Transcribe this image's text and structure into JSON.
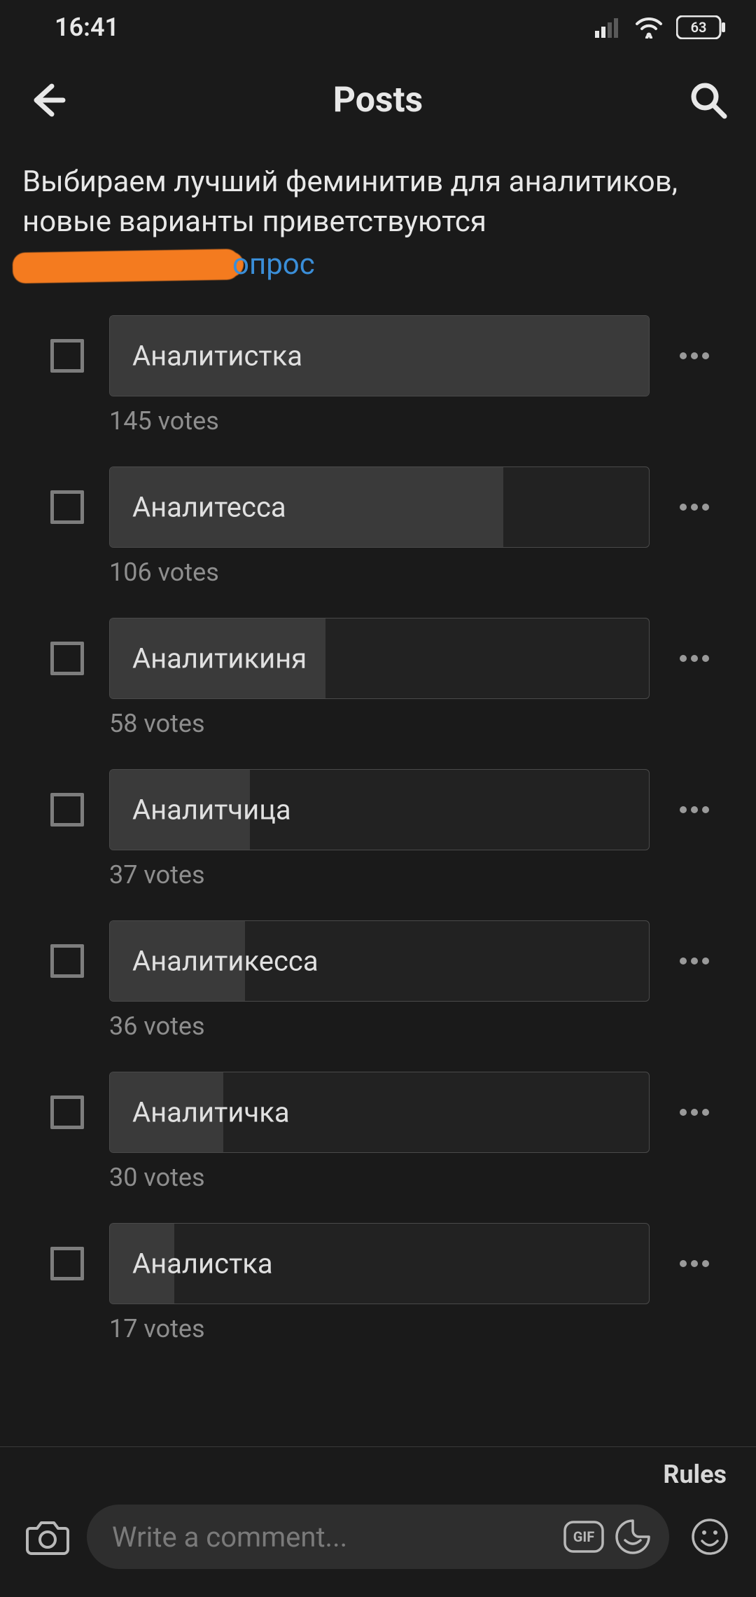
{
  "status": {
    "time": "16:41",
    "battery": "63"
  },
  "header": {
    "title": "Posts"
  },
  "post": {
    "text": "Выбираем лучший феминитив для аналитиков, новые варианты приветствуются",
    "hashtag": "опрос"
  },
  "poll": {
    "votes_word": "votes",
    "options": [
      {
        "label": "Аналитистка",
        "votes": 145,
        "pct": 100
      },
      {
        "label": "Аналитесса",
        "votes": 106,
        "pct": 73
      },
      {
        "label": "Аналитикиня",
        "votes": 58,
        "pct": 40
      },
      {
        "label": "Аналитчица",
        "votes": 37,
        "pct": 26
      },
      {
        "label": "Аналитикесса",
        "votes": 36,
        "pct": 25
      },
      {
        "label": "Аналитичка",
        "votes": 30,
        "pct": 21
      },
      {
        "label": "Аналистка",
        "votes": 17,
        "pct": 12
      }
    ]
  },
  "bottom": {
    "rules": "Rules",
    "comment_placeholder": "Write a comment..."
  },
  "chart_data": {
    "type": "bar",
    "orientation": "horizontal",
    "title": "",
    "xlabel": "votes",
    "ylabel": "",
    "categories": [
      "Аналитистка",
      "Аналитесса",
      "Аналитикиня",
      "Аналитчица",
      "Аналитикесса",
      "Аналитичка",
      "Аналистка"
    ],
    "values": [
      145,
      106,
      58,
      37,
      36,
      30,
      17
    ]
  }
}
